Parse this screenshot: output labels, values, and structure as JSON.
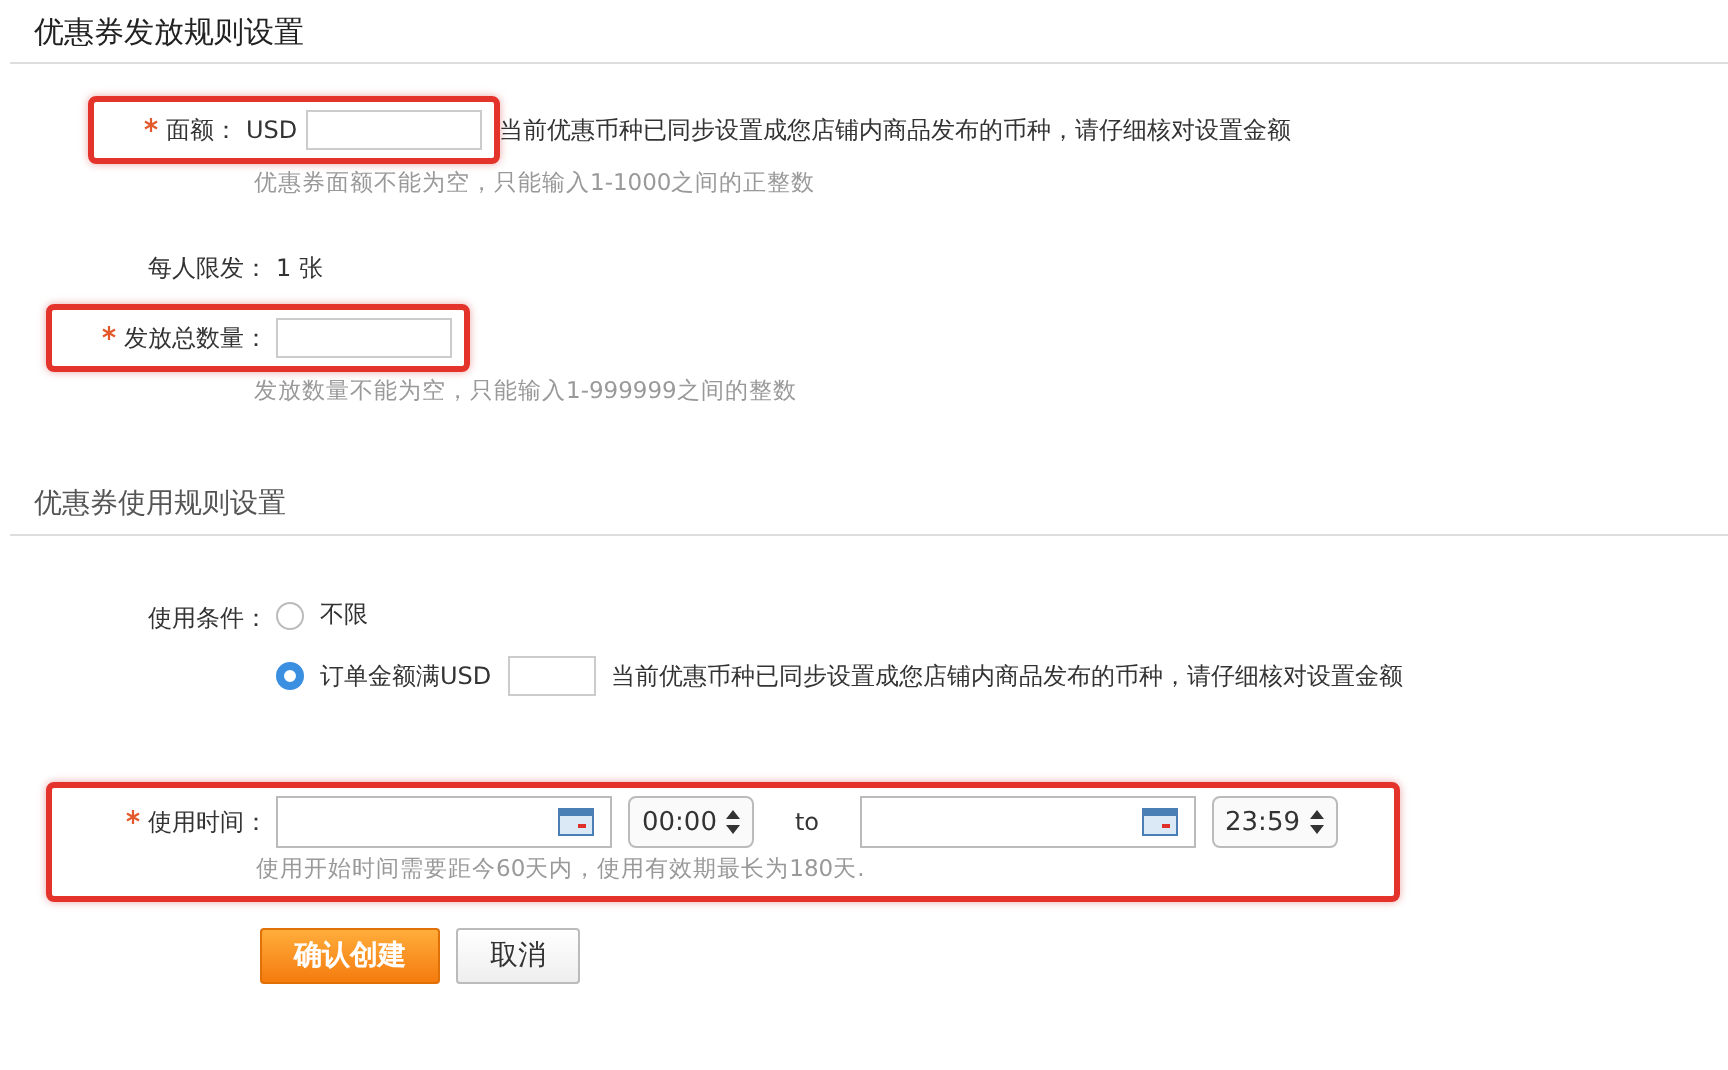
{
  "sections": [
    {
      "title": "优惠券发放规则设置",
      "rows": [
        {
          "kind": "amount",
          "required": true,
          "highlighted": true,
          "label": "面额：",
          "prefix": "USD",
          "note": "当前优惠币种已同步设置成您店铺内商品发布的币种，请仔细核对设置金额",
          "hint": "优惠券面额不能为空，只能输入1-1000之间的正整数"
        },
        {
          "kind": "static",
          "required": false,
          "highlighted": false,
          "label": "每人限发：",
          "value": "1 张"
        },
        {
          "kind": "input",
          "required": true,
          "highlighted": true,
          "label": "发放总数量：",
          "hint": "发放数量不能为空，只能输入1-999999之间的整数"
        }
      ]
    },
    {
      "title": "优惠券使用规则设置",
      "rows": [
        {
          "kind": "radios",
          "required": false,
          "highlighted": false,
          "label": "使用条件：",
          "options": [
            {
              "label": "不限",
              "selected": false
            },
            {
              "label": "订单金额满USD",
              "selected": true,
              "note": "当前优惠币种已同步设置成您店铺内商品发布的币种，请仔细核对设置金额"
            }
          ]
        },
        {
          "kind": "daterange",
          "required": true,
          "highlighted": true,
          "label": "使用时间：",
          "start_time": "00:00",
          "separator": "to",
          "end_time": "23:59",
          "hint": "使用开始时间需要距今60天内，使用有效期最长为180天."
        }
      ]
    }
  ],
  "buttons": [
    {
      "label": "确认创建",
      "primary": true
    },
    {
      "label": "取消",
      "primary": false
    }
  ]
}
